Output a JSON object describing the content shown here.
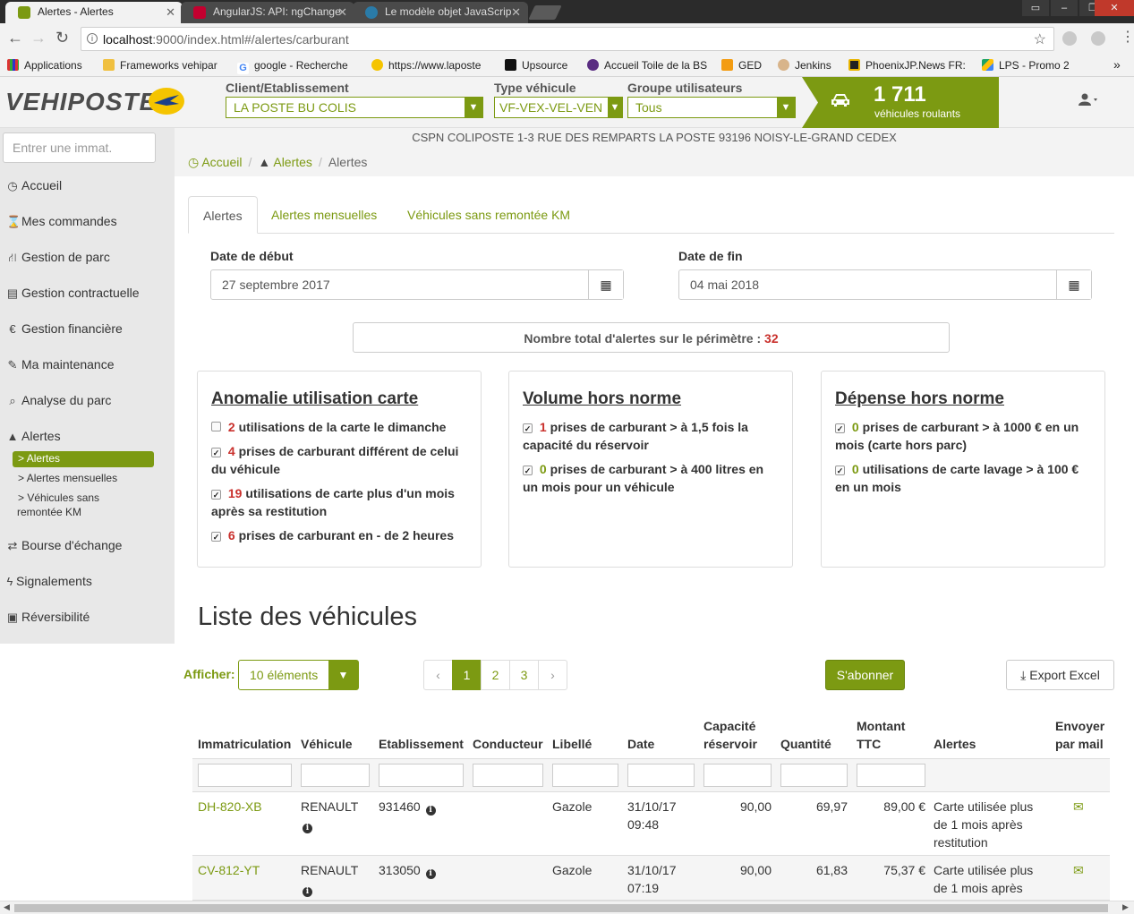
{
  "browser": {
    "tabs": [
      {
        "title": "Alertes - Alertes",
        "active": true
      },
      {
        "title": "AngularJS: API: ngChange",
        "active": false
      },
      {
        "title": "Le modèle objet JavaScrip",
        "active": false
      }
    ],
    "url_host": "localhost",
    "url_path": ":9000/index.html#/alertes/carburant",
    "bookmarks": [
      "Applications",
      "Frameworks vehipar",
      "google - Recherche",
      "https://www.laposte",
      "Upsource",
      "Accueil Toile de la BS",
      "GED",
      "Jenkins",
      "PhoenixJP.News FR:",
      "LPS - Promo 2"
    ]
  },
  "header": {
    "logo": "VEHIPOSTE",
    "client_label": "Client/Etablissement",
    "client_value": "LA POSTE BU COLIS",
    "type_label": "Type véhicule",
    "type_value": "VF-VEX-VEL-VEN",
    "group_label": "Groupe utilisateurs",
    "group_value": "Tous",
    "vehicle_count": "1 711",
    "vehicle_sub": "véhicules roulants",
    "address": "CSPN COLIPOSTE 1-3 RUE DES REMPARTS LA POSTE 93196 NOISY-LE-GRAND CEDEX"
  },
  "sidebar": {
    "search_placeholder": "Entrer une immat.",
    "items": [
      {
        "label": "Accueil",
        "icon": "dashboard-icon"
      },
      {
        "label": "Mes commandes",
        "icon": "hourglass-icon"
      },
      {
        "label": "Gestion de parc",
        "icon": "road-icon"
      },
      {
        "label": "Gestion contractuelle",
        "icon": "document-icon"
      },
      {
        "label": "Gestion financière",
        "icon": "euro-icon"
      },
      {
        "label": "Ma maintenance",
        "icon": "wrench-icon"
      },
      {
        "label": "Analyse du parc",
        "icon": "search-icon"
      },
      {
        "label": "Alertes",
        "icon": "warning-icon"
      },
      {
        "label": "Bourse d'échange",
        "icon": "exchange-icon"
      },
      {
        "label": "Signalements",
        "icon": "bolt-icon"
      },
      {
        "label": "Réversibilité",
        "icon": "archive-icon"
      }
    ],
    "subitems": [
      {
        "label": "Alertes"
      },
      {
        "label": "Alertes mensuelles"
      },
      {
        "label": "Véhicules sans"
      },
      {
        "label": "remontée KM"
      }
    ]
  },
  "breadcrumb": {
    "home": "Accueil",
    "alerts_link": "Alertes",
    "current": "Alertes"
  },
  "tabs": [
    "Alertes",
    "Alertes mensuelles",
    "Véhicules sans remontée KM"
  ],
  "dates": {
    "start_label": "Date de début",
    "start_value": "27 septembre 2017",
    "end_label": "Date de fin",
    "end_value": "04 mai 2018"
  },
  "total": {
    "label": "Nombre total d'alertes sur le périmètre :",
    "value": "32"
  },
  "panels": [
    {
      "title": "Anomalie utilisation carte",
      "items": [
        {
          "count": "2",
          "text": "utilisations de la carte le dimanche",
          "checked": false,
          "color": "red"
        },
        {
          "count": "4",
          "text": "prises de carburant différent de celui du véhicule",
          "checked": true,
          "color": "red"
        },
        {
          "count": "19",
          "text": "utilisations de carte plus d'un mois après sa restitution",
          "checked": true,
          "color": "red"
        },
        {
          "count": "6",
          "text": "prises de carburant en - de 2 heures",
          "checked": true,
          "color": "red"
        }
      ]
    },
    {
      "title": "Volume hors norme",
      "items": [
        {
          "count": "1",
          "text": "prises de carburant > à 1,5 fois la capacité du réservoir",
          "checked": true,
          "color": "red"
        },
        {
          "count": "0",
          "text": "prises de carburant > à 400 litres en un mois pour un véhicule",
          "checked": true,
          "color": "green"
        }
      ]
    },
    {
      "title": "Dépense hors norme",
      "items": [
        {
          "count": "0",
          "text": "prises de carburant > à 1000 € en un mois (carte hors parc)",
          "checked": true,
          "color": "green"
        },
        {
          "count": "0",
          "text": "utilisations de carte lavage > à 100 € en un mois",
          "checked": true,
          "color": "green"
        }
      ]
    }
  ],
  "list": {
    "title": "Liste des véhicules",
    "show_label": "Afficher:",
    "show_value": "10 éléments",
    "pages": [
      "‹",
      "1",
      "2",
      "3",
      "›"
    ],
    "active_page": "1",
    "subscribe": "S'abonner",
    "export": "Export Excel",
    "columns": [
      [
        "Immatriculation"
      ],
      [
        "Véhicule"
      ],
      [
        "Etablissement"
      ],
      [
        "Conducteur"
      ],
      [
        "Libellé"
      ],
      [
        "Date"
      ],
      [
        "Capacité",
        "réservoir"
      ],
      [
        "Quantité"
      ],
      [
        "Montant",
        "TTC"
      ],
      [
        "Alertes"
      ],
      [
        "Envoyer",
        "par mail"
      ]
    ],
    "rows": [
      {
        "immat": "DH-820-XB",
        "vehicle": "RENAULT",
        "etab": "931460",
        "driver": "",
        "libelle": "Gazole",
        "date": "31/10/17",
        "time": "09:48",
        "capacity": "90,00",
        "quantity": "69,97",
        "amount": "89,00 €",
        "alert": [
          "Carte utilisée plus",
          "de 1 mois après",
          "restitution"
        ]
      },
      {
        "immat": "CV-812-YT",
        "vehicle": "RENAULT",
        "etab": "313050",
        "driver": "",
        "libelle": "Gazole",
        "date": "31/10/17",
        "time": "07:19",
        "capacity": "90,00",
        "quantity": "61,83",
        "amount": "75,37 €",
        "alert": [
          "Carte utilisée plus",
          "de 1 mois après",
          ""
        ]
      }
    ]
  },
  "colors": {
    "accent": "#7c9a12",
    "alert_red": "#c9302c"
  }
}
